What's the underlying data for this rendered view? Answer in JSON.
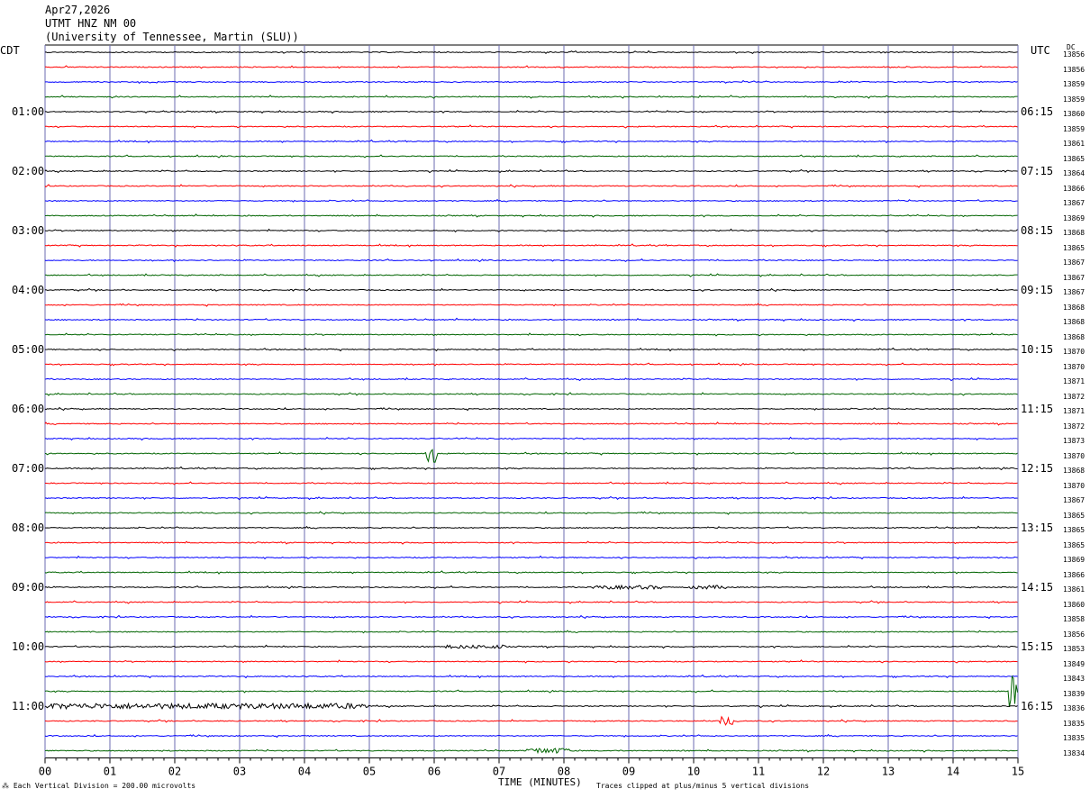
{
  "header": {
    "date": "Apr27,2026",
    "station": "UTMT HNZ NM 00",
    "network": "(University of Tennessee, Martin (SLU))"
  },
  "left_zone_label": "CDT",
  "right_zone_label": "UTC",
  "dc_label": "DC",
  "colors": {
    "black": "#000000",
    "red": "#ff0000",
    "blue": "#0000ff",
    "green": "#006400",
    "grid": "#6b6bb0"
  },
  "chart_data": {
    "type": "line",
    "title": "UTMT HNZ NM 00",
    "xlabel": "TIME (MINUTES)",
    "xlim": [
      0,
      15
    ],
    "x_tick_labels": [
      "00",
      "01",
      "02",
      "03",
      "04",
      "05",
      "06",
      "07",
      "08",
      "09",
      "10",
      "11",
      "12",
      "13",
      "14",
      "15"
    ],
    "left_time_labels": [
      "01:00",
      "02:00",
      "03:00",
      "04:00",
      "05:00",
      "06:00",
      "07:00",
      "08:00",
      "09:00",
      "10:00",
      "11:00"
    ],
    "right_time_labels": [
      "06:15",
      "07:15",
      "08:15",
      "09:15",
      "10:15",
      "11:15",
      "12:15",
      "13:15",
      "14:15",
      "15:15",
      "16:15"
    ],
    "trace_count": 48,
    "trace_color_cycle": [
      "black",
      "red",
      "blue",
      "green"
    ],
    "dc_offsets": [
      13856,
      13856,
      13859,
      13859,
      13860,
      13859,
      13861,
      13865,
      13864,
      13866,
      13867,
      13869,
      13868,
      13865,
      13867,
      13867,
      13867,
      13868,
      13868,
      13868,
      13870,
      13870,
      13871,
      13872,
      13871,
      13872,
      13873,
      13870,
      13868,
      13870,
      13867,
      13865,
      13865,
      13865,
      13869,
      13866,
      13861,
      13860,
      13858,
      13856,
      13853,
      13849,
      13843,
      13839,
      13836,
      13835,
      13835,
      13834
    ],
    "events": [
      {
        "trace": 27,
        "minute": 5.9,
        "amplitude": 10,
        "duration": 0.15
      },
      {
        "trace": 43,
        "minute": 14.9,
        "amplitude": 20,
        "duration": 0.18
      },
      {
        "trace": 45,
        "minute": 10.45,
        "amplitude": 5,
        "duration": 0.15
      },
      {
        "trace": 44,
        "minute": 0.0,
        "amplitude": 3,
        "duration": 5.0
      },
      {
        "trace": 47,
        "minute": 7.5,
        "amplitude": 3,
        "duration": 0.6
      },
      {
        "trace": 40,
        "minute": 6.2,
        "amplitude": 2,
        "duration": 0.9
      },
      {
        "trace": 36,
        "minute": 8.5,
        "amplitude": 2,
        "duration": 1.0
      },
      {
        "trace": 36,
        "minute": 10.0,
        "amplitude": 2,
        "duration": 0.5
      }
    ]
  },
  "footer": {
    "vertical_division": "Each Vertical Division =  200.00 microvolts",
    "clip_note": "Traces clipped at plus/minus 5 vertical divisions"
  }
}
